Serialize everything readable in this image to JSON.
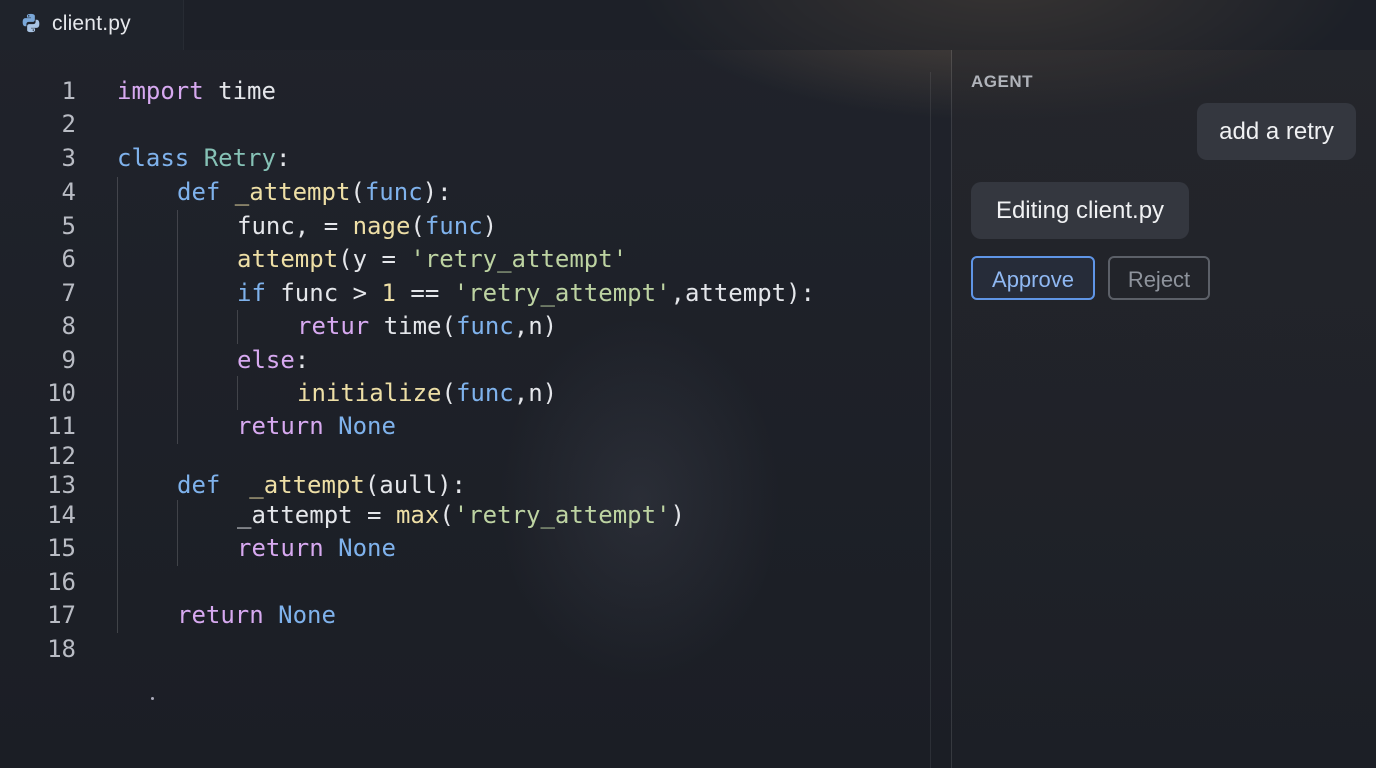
{
  "tab": {
    "filename": "client.py",
    "icon": "python-icon"
  },
  "editor": {
    "lines": [
      {
        "n": "1",
        "tokens": [
          [
            "kw2",
            "import"
          ],
          [
            "",
            "time"
          ]
        ],
        "indent": 0
      },
      {
        "n": "2",
        "tokens": [],
        "indent": 0
      },
      {
        "n": "3",
        "tokens": [
          [
            "kw",
            "class"
          ],
          [
            "cls",
            "Retry"
          ],
          [
            "",
            ":"
          ]
        ],
        "indent": 0
      },
      {
        "n": "4",
        "tokens": [
          [
            "kw",
            "def"
          ],
          [
            "fn",
            "_attempt"
          ],
          [
            "",
            "("
          ],
          [
            "kw",
            "func"
          ],
          [
            "",
            "):"
          ]
        ],
        "indent": 1
      },
      {
        "n": "5",
        "tokens": [
          [
            "",
            "func, = "
          ],
          [
            "fn",
            "nage"
          ],
          [
            "",
            "("
          ],
          [
            "kw",
            "func"
          ],
          [
            "",
            ")"
          ]
        ],
        "indent": 2
      },
      {
        "n": "6",
        "tokens": [
          [
            "fn",
            "attempt"
          ],
          [
            "",
            "(y = "
          ],
          [
            "str",
            "'retry_attempt'"
          ]
        ],
        "indent": 2
      },
      {
        "n": "7",
        "tokens": [
          [
            "kw",
            "if"
          ],
          [
            "",
            " func > "
          ],
          [
            "num",
            "1"
          ],
          [
            "",
            " == "
          ],
          [
            "str",
            "'retry_attempt'"
          ],
          [
            "",
            ",attempt):"
          ]
        ],
        "indent": 2
      },
      {
        "n": "8",
        "tokens": [
          [
            "kw2",
            "retur"
          ],
          [
            "",
            " time("
          ],
          [
            "kw",
            "func"
          ],
          [
            "",
            ",n)"
          ]
        ],
        "indent": 3
      },
      {
        "n": "9",
        "tokens": [
          [
            "kw2",
            "else"
          ],
          [
            "",
            ":"
          ]
        ],
        "indent": 2
      },
      {
        "n": "10",
        "tokens": [
          [
            "fn",
            "initialize"
          ],
          [
            "",
            "("
          ],
          [
            "kw",
            "func"
          ],
          [
            "",
            ",n)"
          ]
        ],
        "indent": 3
      },
      {
        "n": "11",
        "tokens": [
          [
            "kw2",
            "return"
          ],
          [
            "",
            " "
          ],
          [
            "kw",
            "None"
          ]
        ],
        "indent": 2
      },
      {
        "n": "12",
        "tokens": [],
        "indent": 0
      },
      {
        "n": "13",
        "tokens": [
          [
            "kw",
            "def"
          ],
          [
            "",
            " "
          ],
          [
            "fn",
            "_attempt"
          ],
          [
            "",
            "(aull):"
          ]
        ],
        "indent": 1
      },
      {
        "n": "14",
        "tokens": [
          [
            "",
            "_attempt = "
          ],
          [
            "fn",
            "max"
          ],
          [
            "",
            "("
          ],
          [
            "str",
            "'retry_attempt'"
          ],
          [
            "",
            ")"
          ]
        ],
        "indent": 2
      },
      {
        "n": "15",
        "tokens": [
          [
            "kw2",
            "return"
          ],
          [
            "",
            " "
          ],
          [
            "kw",
            "None"
          ]
        ],
        "indent": 2
      },
      {
        "n": "16",
        "tokens": [],
        "indent": 0
      },
      {
        "n": "17",
        "tokens": [
          [
            "kw2",
            "return"
          ],
          [
            "",
            " "
          ],
          [
            "kw",
            "None"
          ]
        ],
        "indent": 1
      },
      {
        "n": "18",
        "tokens": [],
        "indent": 0
      }
    ]
  },
  "agent": {
    "title": "AGENT",
    "user_message": "add a retry",
    "agent_message": "Editing client.py",
    "approve_label": "Approve",
    "reject_label": "Reject"
  },
  "colors": {
    "accent": "#5f95e6",
    "keyword": "#7fb2ec",
    "keyword_purple": "#d7a9f0",
    "function": "#eedfa6",
    "string": "#bdd3a2"
  }
}
